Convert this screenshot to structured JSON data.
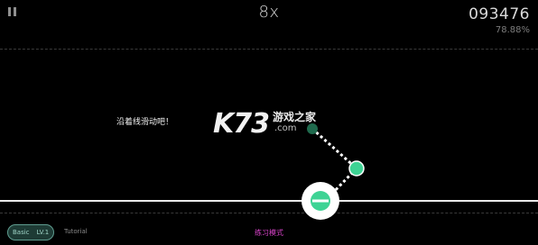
{
  "hud": {
    "combo": "8x",
    "score": "093476",
    "accuracy": "78.88%"
  },
  "hint": {
    "text": "沿着线滑动吧！"
  },
  "watermark": {
    "logo": "K73",
    "cn": "游戏之家",
    "domain": ".com"
  },
  "footer": {
    "difficulty": "Basic",
    "level": "LV.1",
    "chart_name": "Tutorial",
    "mode": "练习模式"
  },
  "colors": {
    "note_green": "#3ed394",
    "note_dark_green": "#1f6a4d",
    "mode_text": "#d642c7",
    "badge_border": "#5f9d90"
  },
  "icons": {
    "pause": "pause-icon"
  }
}
